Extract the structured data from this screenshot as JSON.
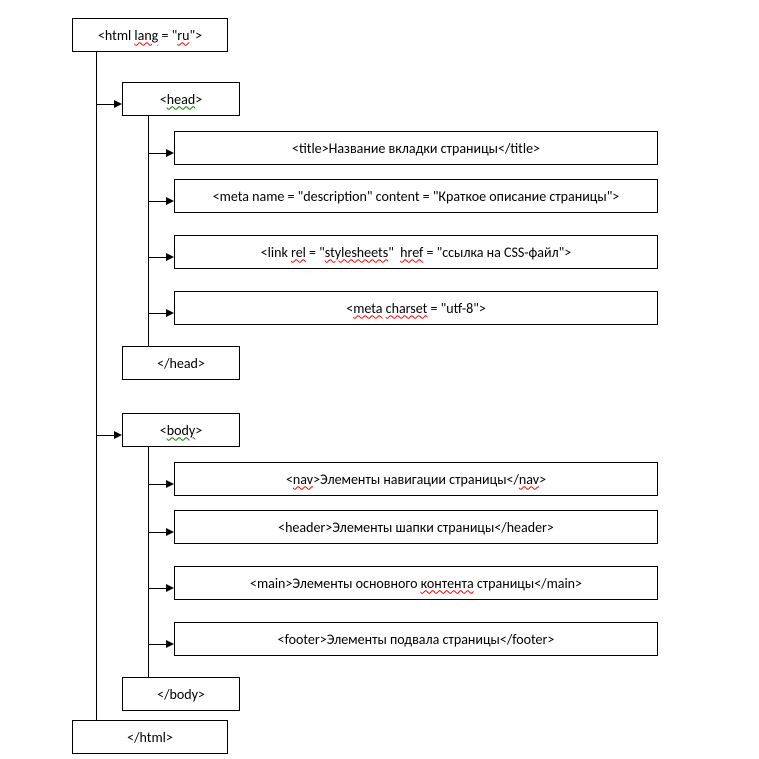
{
  "root_open": "<html lang = \"ru\">",
  "root_close": "</html>",
  "head_open": "<head>",
  "head_close": "</head>",
  "body_open": "<body>",
  "body_close": "</body>",
  "head_children": {
    "title": "<title>Название вкладки страницы</title>",
    "meta_desc": "<meta name = \"description\" content = \"Краткое описание страницы\">",
    "link": "<link rel = \"stylesheets\"  href = \"ссылка на CSS-файл\">",
    "meta_charset": "<meta charset = \"utf-8\">"
  },
  "body_children": {
    "nav": "<nav>Элементы навигации страницы</nav>",
    "header": "<header>Элементы шапки страницы</header>",
    "main": "<main>Элементы основного контента страницы</main>",
    "footer": "<footer>Элементы подвала страницы</footer>"
  }
}
